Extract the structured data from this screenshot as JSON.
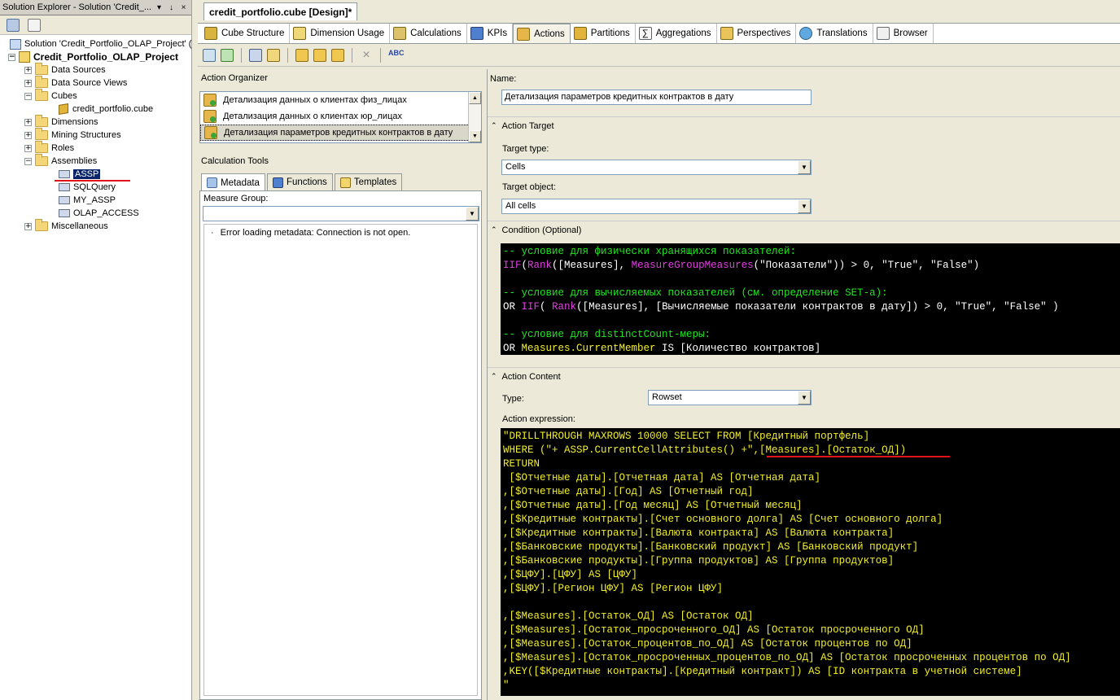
{
  "solution_explorer": {
    "title": "Solution Explorer - Solution 'Credit_...",
    "pin": "↓",
    "close": "×",
    "solution": "Solution 'Credit_Portfolio_OLAP_Project' (",
    "project": "Credit_Portfolio_OLAP_Project",
    "items": [
      {
        "label": "Data Sources"
      },
      {
        "label": "Data Source Views"
      },
      {
        "label": "Cubes"
      },
      {
        "label": "credit_portfolio.cube"
      },
      {
        "label": "Dimensions"
      },
      {
        "label": "Mining Structures"
      },
      {
        "label": "Roles"
      },
      {
        "label": "Assemblies"
      },
      {
        "label": "ASSP"
      },
      {
        "label": "SQLQuery"
      },
      {
        "label": "MY_ASSP"
      },
      {
        "label": "OLAP_ACCESS"
      },
      {
        "label": "Miscellaneous"
      }
    ]
  },
  "document_tab": "credit_portfolio.cube [Design]*",
  "designer_tabs": [
    {
      "label": "Cube Structure"
    },
    {
      "label": "Dimension Usage"
    },
    {
      "label": "Calculations"
    },
    {
      "label": "KPIs"
    },
    {
      "label": "Actions"
    },
    {
      "label": "Partitions"
    },
    {
      "label": "Aggregations"
    },
    {
      "label": "Perspectives"
    },
    {
      "label": "Translations"
    },
    {
      "label": "Browser"
    }
  ],
  "action_organizer": {
    "title": "Action Organizer",
    "items": [
      "Детализация данных о клиентах физ_лицах",
      "Детализация данных о клиентах юр_лицах",
      "Детализация параметров кредитных контрактов в дату"
    ]
  },
  "calc_tools": {
    "title": "Calculation Tools",
    "tabs": [
      "Metadata",
      "Functions",
      "Templates"
    ],
    "measure_group_label": "Measure Group:",
    "measure_group_value": "",
    "error": "Error loading metadata: Connection is not open."
  },
  "form": {
    "name_label": "Name:",
    "name_value": "Детализация параметров кредитных контрактов в дату",
    "target_section": "Action Target",
    "target_type_label": "Target type:",
    "target_type_value": "Cells",
    "target_object_label": "Target object:",
    "target_object_value": "All cells",
    "condition_section": "Condition (Optional)",
    "content_section": "Action Content",
    "type_label": "Type:",
    "type_value": "Rowset",
    "expression_label": "Action expression:"
  },
  "condition_lines": [
    [
      {
        "c": "green",
        "t": "-- условие для физически хранящихся показателей:"
      }
    ],
    [
      {
        "c": "mag",
        "t": "IIF"
      },
      {
        "c": "white",
        "t": "("
      },
      {
        "c": "mag",
        "t": "Rank"
      },
      {
        "c": "white",
        "t": "([Measures], "
      },
      {
        "c": "mag",
        "t": "MeasureGroupMeasures"
      },
      {
        "c": "white",
        "t": "(\"Показатели\")) > 0, \"True\", \"False\")"
      }
    ],
    [
      {
        "c": "white",
        "t": ""
      }
    ],
    [
      {
        "c": "green",
        "t": "-- условие для вычисляемых показателей (см. определение SET-а):"
      }
    ],
    [
      {
        "c": "white",
        "t": "OR "
      },
      {
        "c": "mag",
        "t": "IIF"
      },
      {
        "c": "white",
        "t": "( "
      },
      {
        "c": "mag",
        "t": "Rank"
      },
      {
        "c": "white",
        "t": "([Measures], [Вычисляемые показатели контрактов в дату]) > 0, \"True\", \"False\" )"
      }
    ],
    [
      {
        "c": "white",
        "t": ""
      }
    ],
    [
      {
        "c": "green",
        "t": "-- условие для distinctCount-меры:"
      }
    ],
    [
      {
        "c": "white",
        "t": "OR "
      },
      {
        "c": "yel",
        "t": "Measures.CurrentMember"
      },
      {
        "c": "white",
        "t": " IS [Количество контрактов]"
      }
    ]
  ],
  "expression_lines": [
    "\"DRILLTHROUGH MAXROWS 10000 SELECT FROM [Кредитный портфель]",
    "WHERE (\"+ ASSP.CurrentCellAttributes() +\",[Measures].[Остаток_ОД])",
    "RETURN",
    " [$Отчетные даты].[Отчетная дата] AS [Отчетная дата]",
    ",[$Отчетные даты].[Год] AS [Отчетный год]",
    ",[$Отчетные даты].[Год месяц] AS [Отчетный месяц]",
    ",[$Кредитные контракты].[Счет основного долга] AS [Счет основного долга]",
    ",[$Кредитные контракты].[Валюта контракта] AS [Валюта контракта]",
    ",[$Банковские продукты].[Банковский продукт] AS [Банковский продукт]",
    ",[$Банковские продукты].[Группа продуктов] AS [Группа продуктов]",
    ",[$ЦФУ].[ЦФУ] AS [ЦФУ]",
    ",[$ЦФУ].[Регион ЦФУ] AS [Регион ЦФУ]",
    "",
    ",[$Measures].[Остаток_ОД] AS [Остаток ОД]",
    ",[$Measures].[Остаток_просроченного_ОД] AS [Остаток просроченного ОД]",
    ",[$Measures].[Остаток_процентов_по_ОД] AS [Остаток процентов по ОД]",
    ",[$Measures].[Остаток_просроченных_процентов_по_ОД] AS [Остаток просроченных процентов по ОД]",
    ",KEY([$Кредитные контракты].[Кредитный контракт]) AS [ID контракта в учетной системе]",
    "\""
  ],
  "colors": {
    "code_bg": "#000000",
    "comment": "#1ee81e",
    "function": "#e03fe0",
    "string": "#f2ee2b",
    "annotation": "#e0121a",
    "selection": "#0a246a"
  }
}
